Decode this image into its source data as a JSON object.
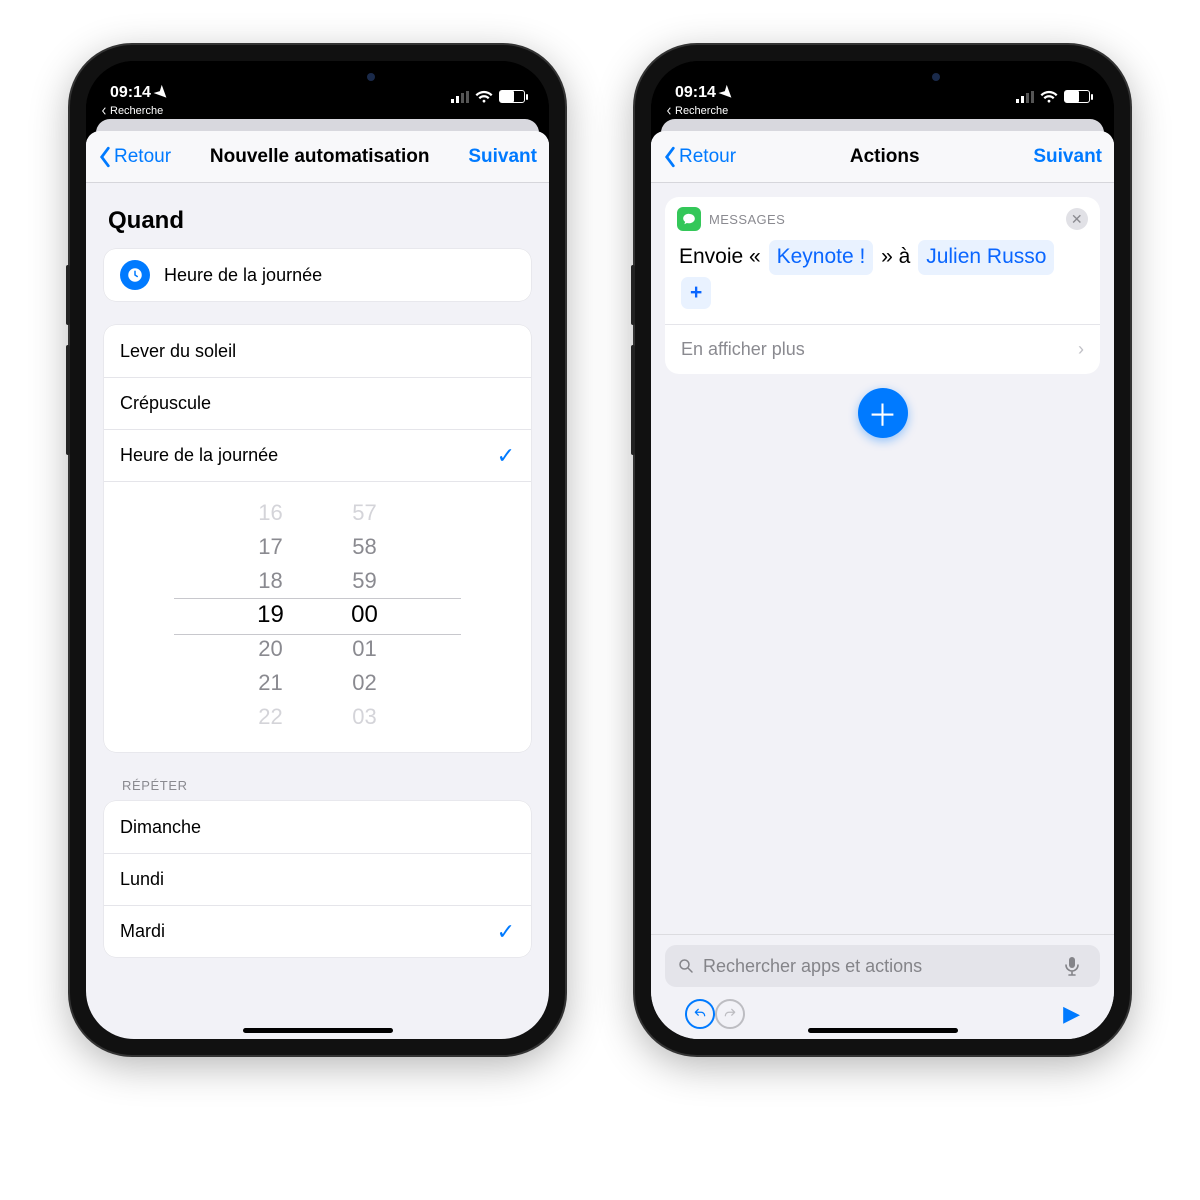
{
  "status": {
    "time": "09:14",
    "back_app": "Recherche"
  },
  "left": {
    "nav": {
      "back": "Retour",
      "title": "Nouvelle automatisation",
      "next": "Suivant"
    },
    "section_when": "Quand",
    "selected_trigger": "Heure de la journée",
    "time_options": {
      "sunrise": "Lever du soleil",
      "sunset": "Crépuscule",
      "time_of_day": "Heure de la journée"
    },
    "picker": {
      "hours": [
        "16",
        "17",
        "18",
        "19",
        "20",
        "21",
        "22"
      ],
      "minutes": [
        "57",
        "58",
        "59",
        "00",
        "01",
        "02",
        "03"
      ],
      "selected_index": 3
    },
    "repeat_label": "RÉPÉTER",
    "repeat_days": [
      "Dimanche",
      "Lundi",
      "Mardi"
    ]
  },
  "right": {
    "nav": {
      "back": "Retour",
      "title": "Actions",
      "next": "Suivant"
    },
    "action": {
      "app": "MESSAGES",
      "prefix": "Envoie «",
      "message_token": "Keynote !",
      "middle": "» à",
      "recipient_token": "Julien Russo",
      "add_token": "+",
      "show_more": "En afficher plus"
    },
    "search_placeholder": "Rechercher apps et actions"
  }
}
